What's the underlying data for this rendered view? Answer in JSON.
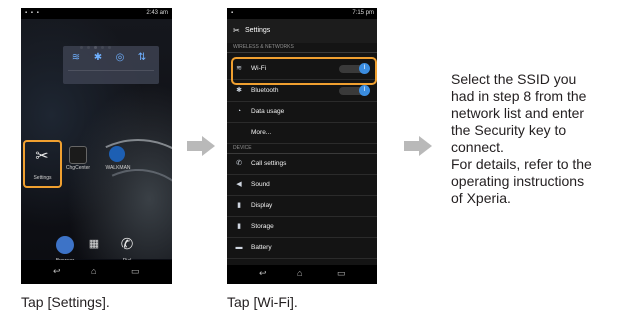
{
  "phone_home": {
    "status_time": "2:43 am",
    "apps": [
      {
        "label": "Settings"
      },
      {
        "label": "ChgCenter"
      },
      {
        "label": "WALKMAN"
      }
    ],
    "dock": [
      {
        "label": "Browser"
      },
      {
        "label": "Dial"
      }
    ]
  },
  "phone_settings": {
    "status_time": "7:15 pm",
    "title": "Settings",
    "section_wireless": "WIRELESS & NETWORKS",
    "items_wireless": [
      {
        "label": "Wi-Fi",
        "icon": "wifi-icon",
        "toggle": "I"
      },
      {
        "label": "Bluetooth",
        "icon": "bluetooth-icon",
        "toggle": "I"
      },
      {
        "label": "Data usage",
        "icon": "data-usage-icon"
      },
      {
        "label": "More...",
        "icon": ""
      }
    ],
    "section_device": "DEVICE",
    "items_device": [
      {
        "label": "Call settings",
        "icon": "phone-icon"
      },
      {
        "label": "Sound",
        "icon": "speaker-icon"
      },
      {
        "label": "Display",
        "icon": "display-icon"
      },
      {
        "label": "Storage",
        "icon": "storage-icon"
      },
      {
        "label": "Battery",
        "icon": "battery-icon"
      }
    ]
  },
  "instruction": {
    "line1": "Select the SSID you",
    "line2": "had in step 8 from the",
    "line3": "network list and enter",
    "line4": "the Security key to",
    "line5": "connect.",
    "line6": "For details, refer to the",
    "line7": "operating instructions",
    "line8": "of Xperia."
  },
  "captions": {
    "step1": "Tap [Settings].",
    "step2": "Tap [Wi-Fi]."
  },
  "colors": {
    "highlight": "#f0a030",
    "toggle_on": "#3b8de0",
    "arrow": "#b9b9b9"
  }
}
